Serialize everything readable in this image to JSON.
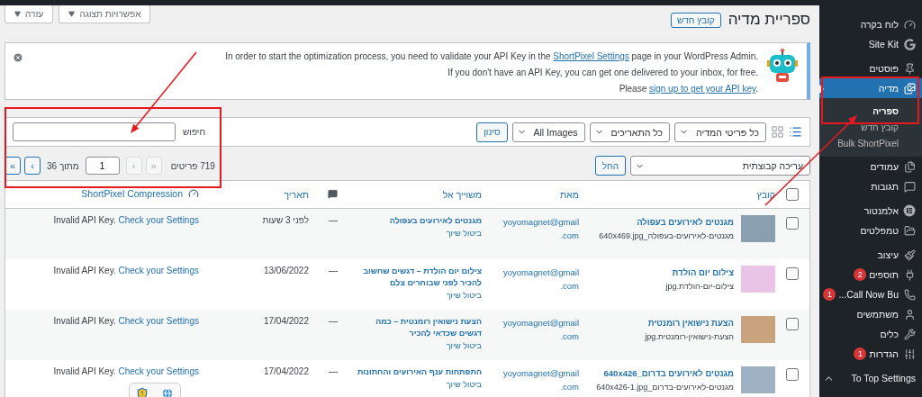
{
  "screen_tabs": [
    {
      "label": "אפשרויות תצוגה"
    },
    {
      "label": "עזרה"
    }
  ],
  "header": {
    "title": "ספריית מדיה",
    "add_button": "קובץ חדש"
  },
  "notice": {
    "lines": [
      {
        "before": "In order to start the optimization process, you need to validate your API Key in the ",
        "link": "ShortPixel Settings",
        "after": " page in your WordPress Admin."
      },
      {
        "before": "If you don't have an API Key, you can get one delivered to your inbox, for free."
      },
      {
        "before": "Please ",
        "link": "sign up to get your API key",
        "after": "."
      }
    ]
  },
  "filters": {
    "views": [
      {
        "selected": true
      },
      {
        "selected": false
      }
    ],
    "selects": [
      "כל פריטי המדיה",
      "כל התאריכים",
      "All Images"
    ],
    "filter_button": "סינון",
    "search": {
      "label": "חיפוש"
    }
  },
  "pagination": {
    "bulk_select": "עריכה קבוצתית",
    "apply_button": "החל",
    "count": "719 פריטים",
    "prev_buttons": [
      {
        "label": "«",
        "disabled": true
      },
      {
        "label": "‹",
        "disabled": true
      }
    ],
    "current_page": "1",
    "of_text": "מתוך 36",
    "next_buttons": [
      {
        "label": "›",
        "disabled": false
      },
      {
        "label": "»",
        "disabled": false
      }
    ]
  },
  "table": {
    "header_checkbox": {
      "checked": false
    },
    "columns": {
      "file": "קובץ",
      "author": "מאת",
      "attached": "משוייך אל",
      "date": "תאריך",
      "shortpixel": "ShortPixel Compression"
    },
    "rows": [
      {
        "checked": false,
        "title": "מגנטים לאירועים בעפולה",
        "filename": "מגנטים-לאירועים-בעפולה_640x469.jpg",
        "author": "yoyomagnet@gmail.com",
        "attached_title": "מגנטים לאירועים בעפולה",
        "detach": "ביטול שיוך",
        "comments": "—",
        "date": "לפני 3 שעות",
        "sp_status": "Invalid API Key.",
        "sp_link": "Check your Settings"
      },
      {
        "checked": false,
        "title": "צילום יום הולדת",
        "filename": "צילום-יום-הולדת.jpg",
        "author": "yoyomagnet@gmail.com",
        "attached_title": "צילום יום הולדת – דגשים שחשוב להכיר לפני שבוחרים צלם",
        "detach": "ביטול שיוך",
        "comments": "—",
        "date": "13/06/2022",
        "sp_status": "Invalid API Key.",
        "sp_link": "Check your Settings"
      },
      {
        "checked": false,
        "title": "הצעת נישואין רומנטית",
        "filename": "הצעת-נישואין-רומנטית.jpg",
        "author": "yoyomagnet@gmail.com",
        "attached_title": "הצעת נישואין רומנטית – כמה דגשים שכדאי להכיר",
        "detach": "ביטול שיוך",
        "comments": "—",
        "date": "17/04/2022",
        "sp_status": "Invalid API Key.",
        "sp_link": "Check your Settings"
      },
      {
        "checked": false,
        "title": "מגנטים לאירועים בדרום_640x426",
        "filename": "מגנטים-לאירועים-בדרום_640x426-1.jpg",
        "author": "yoyomagnet@gmail.com",
        "attached_title": "התפתחות ענף האירועים והחתונות",
        "detach": "ביטול שיוך",
        "comments": "—",
        "date": "17/04/2022",
        "sp_status": "Invalid API Key.",
        "sp_link": "Check your Settings"
      }
    ]
  },
  "sidebar": {
    "groups": [
      [
        {
          "label": "לוח בקרה",
          "selected": false
        },
        {
          "label": "Site Kit",
          "selected": false
        }
      ],
      [
        {
          "label": "פוסטים",
          "selected": false
        },
        {
          "label": "מדיה",
          "selected": true,
          "children": [
            {
              "label": "ספריה",
              "selected": true
            },
            {
              "label": "קובץ חדש",
              "selected": false
            },
            {
              "label": "Bulk ShortPixel",
              "selected": false
            }
          ]
        },
        {
          "label": "עמודים",
          "selected": false
        },
        {
          "label": "תגובות",
          "selected": false
        }
      ],
      [
        {
          "label": "אלמנטור",
          "selected": false
        },
        {
          "label": "טמפלטים",
          "selected": false
        }
      ],
      [
        {
          "label": "עיצוב",
          "selected": false
        },
        {
          "label": "תוספים",
          "selected": false,
          "badge": "2"
        },
        {
          "label": "Call Now Bu...",
          "selected": false,
          "badge": "1"
        },
        {
          "label": "משתמשים",
          "selected": false
        },
        {
          "label": "כלים",
          "selected": false
        },
        {
          "label": "הגדרות",
          "selected": false,
          "badge": "1"
        }
      ],
      [
        {
          "label": "To Top Settings",
          "selected": false
        }
      ]
    ]
  }
}
